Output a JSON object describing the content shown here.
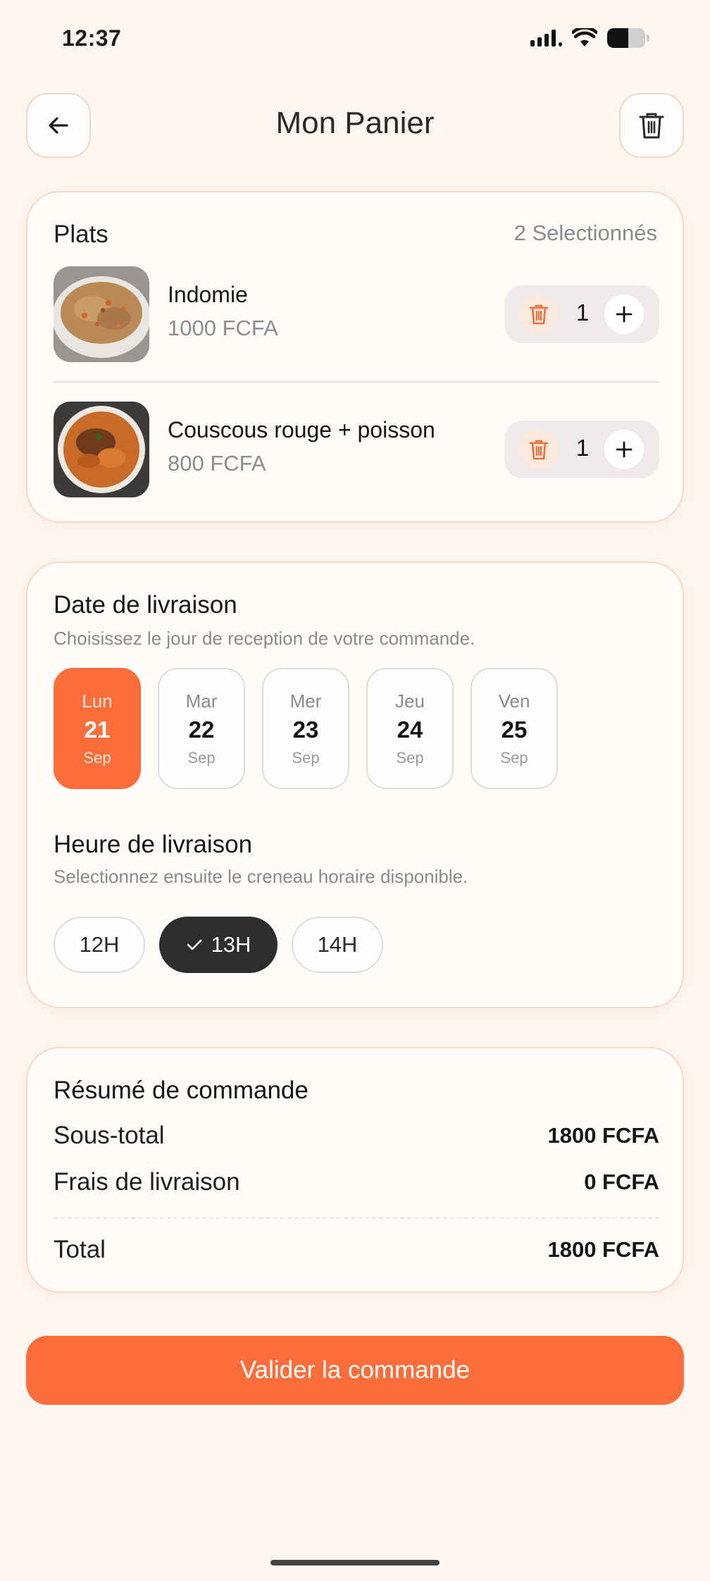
{
  "status_bar": {
    "time": "12:37",
    "battery_level": 0.55
  },
  "header": {
    "title": "Mon Panier",
    "back_icon": "arrow-left-icon",
    "clear_icon": "trash-icon"
  },
  "plats": {
    "title": "Plats",
    "count_label": "2 Selectionnés",
    "items": [
      {
        "name": "Indomie",
        "price": "1000 FCFA",
        "quantity": "1"
      },
      {
        "name": "Couscous rouge + poisson",
        "price": "800 FCFA",
        "quantity": "1"
      }
    ]
  },
  "delivery_date": {
    "title": "Date de livraison",
    "subtitle": "Choisissez le jour de reception de votre commande.",
    "days": [
      {
        "day": "Lun",
        "num": "21",
        "month": "Sep",
        "selected": true
      },
      {
        "day": "Mar",
        "num": "22",
        "month": "Sep",
        "selected": false
      },
      {
        "day": "Mer",
        "num": "23",
        "month": "Sep",
        "selected": false
      },
      {
        "day": "Jeu",
        "num": "24",
        "month": "Sep",
        "selected": false
      },
      {
        "day": "Ven",
        "num": "25",
        "month": "Sep",
        "selected": false
      }
    ]
  },
  "delivery_hour": {
    "title": "Heure de livraison",
    "subtitle": "Selectionnez ensuite le creneau horaire disponible.",
    "hours": [
      {
        "label": "12H",
        "selected": false
      },
      {
        "label": "13H",
        "selected": true
      },
      {
        "label": "14H",
        "selected": false
      }
    ]
  },
  "summary": {
    "title": "Résumé de commande",
    "subtotal_label": "Sous-total",
    "subtotal_value": "1800 FCFA",
    "fee_label": "Frais de livraison",
    "fee_value": "0 FCFA",
    "total_label": "Total",
    "total_value": "1800 FCFA"
  },
  "cta": {
    "label": "Valider la commande"
  },
  "colors": {
    "accent": "#fb6d3a",
    "dark": "#2d2d2d",
    "background": "#fdf6f1"
  }
}
